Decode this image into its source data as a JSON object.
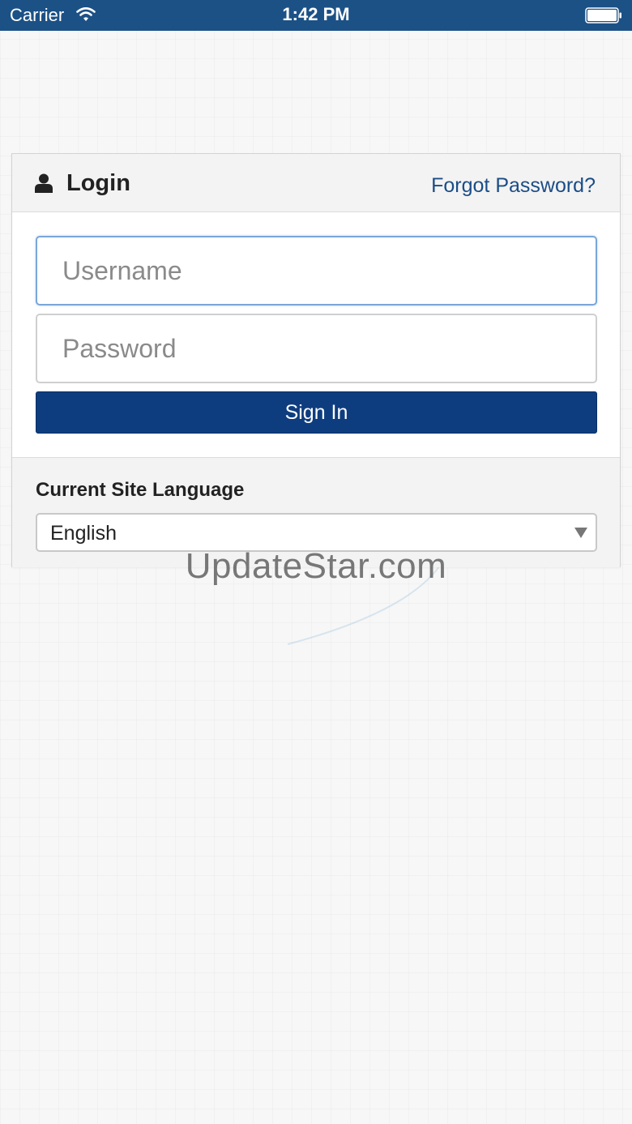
{
  "status_bar": {
    "carrier": "Carrier",
    "time": "1:42 PM",
    "wifi_icon": "wifi-icon",
    "battery_icon": "battery-icon"
  },
  "login_panel": {
    "title": "Login",
    "user_icon": "user-icon",
    "forgot_password": "Forgot Password?",
    "username": {
      "value": "",
      "placeholder": "Username"
    },
    "password": {
      "value": "",
      "placeholder": "Password"
    },
    "sign_in_label": "Sign In"
  },
  "language": {
    "label": "Current Site Language",
    "selected": "English",
    "dropdown_icon": "chevron-down-icon"
  },
  "watermark": "UpdateStar.com",
  "colors": {
    "status_bar": "#1c5186",
    "button": "#0e3d7f",
    "link": "#1b4d87",
    "focus_border": "#7aa6d9"
  }
}
